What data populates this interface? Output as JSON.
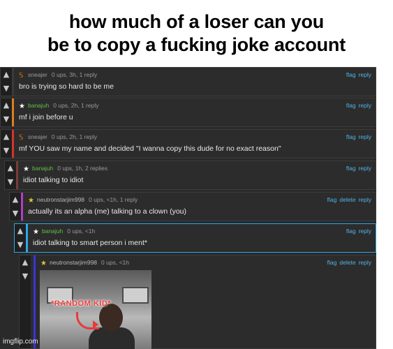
{
  "caption": "how much of a loser can you\nbe to copy a fucking joke account",
  "comments": [
    {
      "user": "sneajer",
      "meta": "0 ups, 3h, 1 reply",
      "text": "bro is trying so hard to be me",
      "actions": [
        "flag",
        "reply"
      ],
      "bar_color": "#3a3a3a",
      "user_color": "#9a9a9a",
      "avatar": "S"
    },
    {
      "user": "banajuh",
      "meta": "0 ups, 2h, 1 reply",
      "text": "mf i join before u",
      "actions": [
        "flag",
        "reply"
      ],
      "bar_color": "#e07f1a",
      "user_color": "#62c044",
      "avatar": "★"
    },
    {
      "user": "sneajer",
      "meta": "0 ups, 2h, 1 reply",
      "text": "mf YOU saw my name and decided \"I wanna copy this dude for no exact reason\"",
      "actions": [
        "flag",
        "reply"
      ],
      "bar_color": "#d8342c",
      "user_color": "#9a9a9a",
      "avatar": "S"
    },
    {
      "user": "banajuh",
      "meta": "0 ups, 1h, 2 replies",
      "text": "idiot talking to idiot",
      "actions": [
        "flag",
        "reply"
      ],
      "bar_color": "#7a3a3a",
      "user_color": "#62c044",
      "avatar": "★"
    },
    {
      "user": "neutronstarjim998",
      "meta": "0 ups, <1h, 1 reply",
      "text": "actually its an alpha (me) talking to a clown (you)",
      "actions": [
        "flag",
        "delete",
        "reply"
      ],
      "bar_color": "#b23cc8",
      "user_color": "#b9b9b9",
      "avatar": "★"
    },
    {
      "user": "banajuh",
      "meta": "0 ups, <1h",
      "text": "idiot talking to smart person i ment*",
      "actions": [
        "flag",
        "reply"
      ],
      "bar_color": "#2da7e8",
      "user_color": "#62c044",
      "avatar": "★"
    },
    {
      "user": "neutronstarjim998",
      "meta": "0 ups, <1h",
      "text": "",
      "actions": [
        "flag",
        "delete",
        "reply"
      ],
      "bar_color": "#3a35d8",
      "user_color": "#b9b9b9",
      "avatar": "★"
    }
  ],
  "image_tag": "*RANDOM KID*",
  "watermark": "imgflip.com",
  "icons": {
    "upvote": "arrow-up-icon",
    "downvote": "arrow-down-icon"
  }
}
